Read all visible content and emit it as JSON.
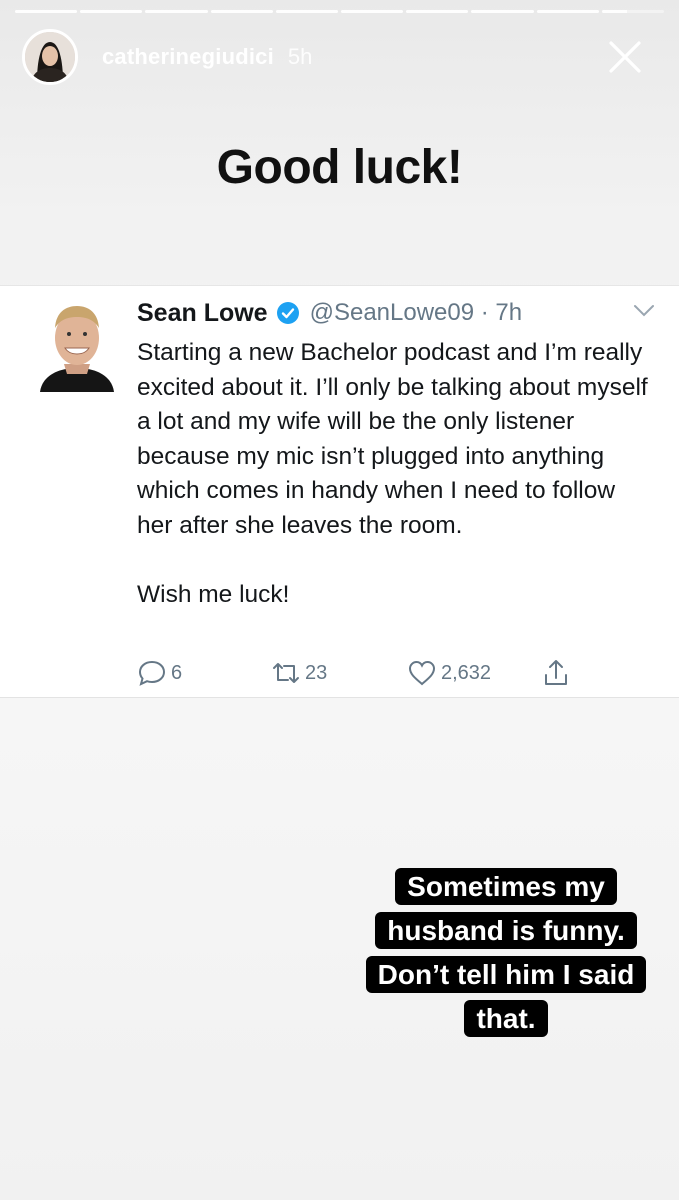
{
  "story": {
    "username": "catherinegiudici",
    "time_ago": "5h",
    "segments": 10,
    "title_text": "Good luck!",
    "caption": "Sometimes my husband is funny. Don’t tell him I said that."
  },
  "tweet": {
    "name": "Sean Lowe",
    "handle_time": "@SeanLowe09 · 7h",
    "body": "Starting a new Bachelor podcast and I’m really excited about it. I’ll only be talking about myself a lot and my wife will be the only listener because my mic isn’t plugged into anything which comes in handy when I need to follow her after she leaves the room.",
    "signoff": "Wish me luck!",
    "replies": "6",
    "retweets": "23",
    "likes": "2,632"
  },
  "colors": {
    "verified_blue": "#1da1f2",
    "action_gray": "#657786",
    "caption_bg": "#000000"
  },
  "icons": [
    "close-icon",
    "verified-badge-icon",
    "chevron-down-icon",
    "reply-icon",
    "retweet-icon",
    "like-icon",
    "share-icon"
  ]
}
